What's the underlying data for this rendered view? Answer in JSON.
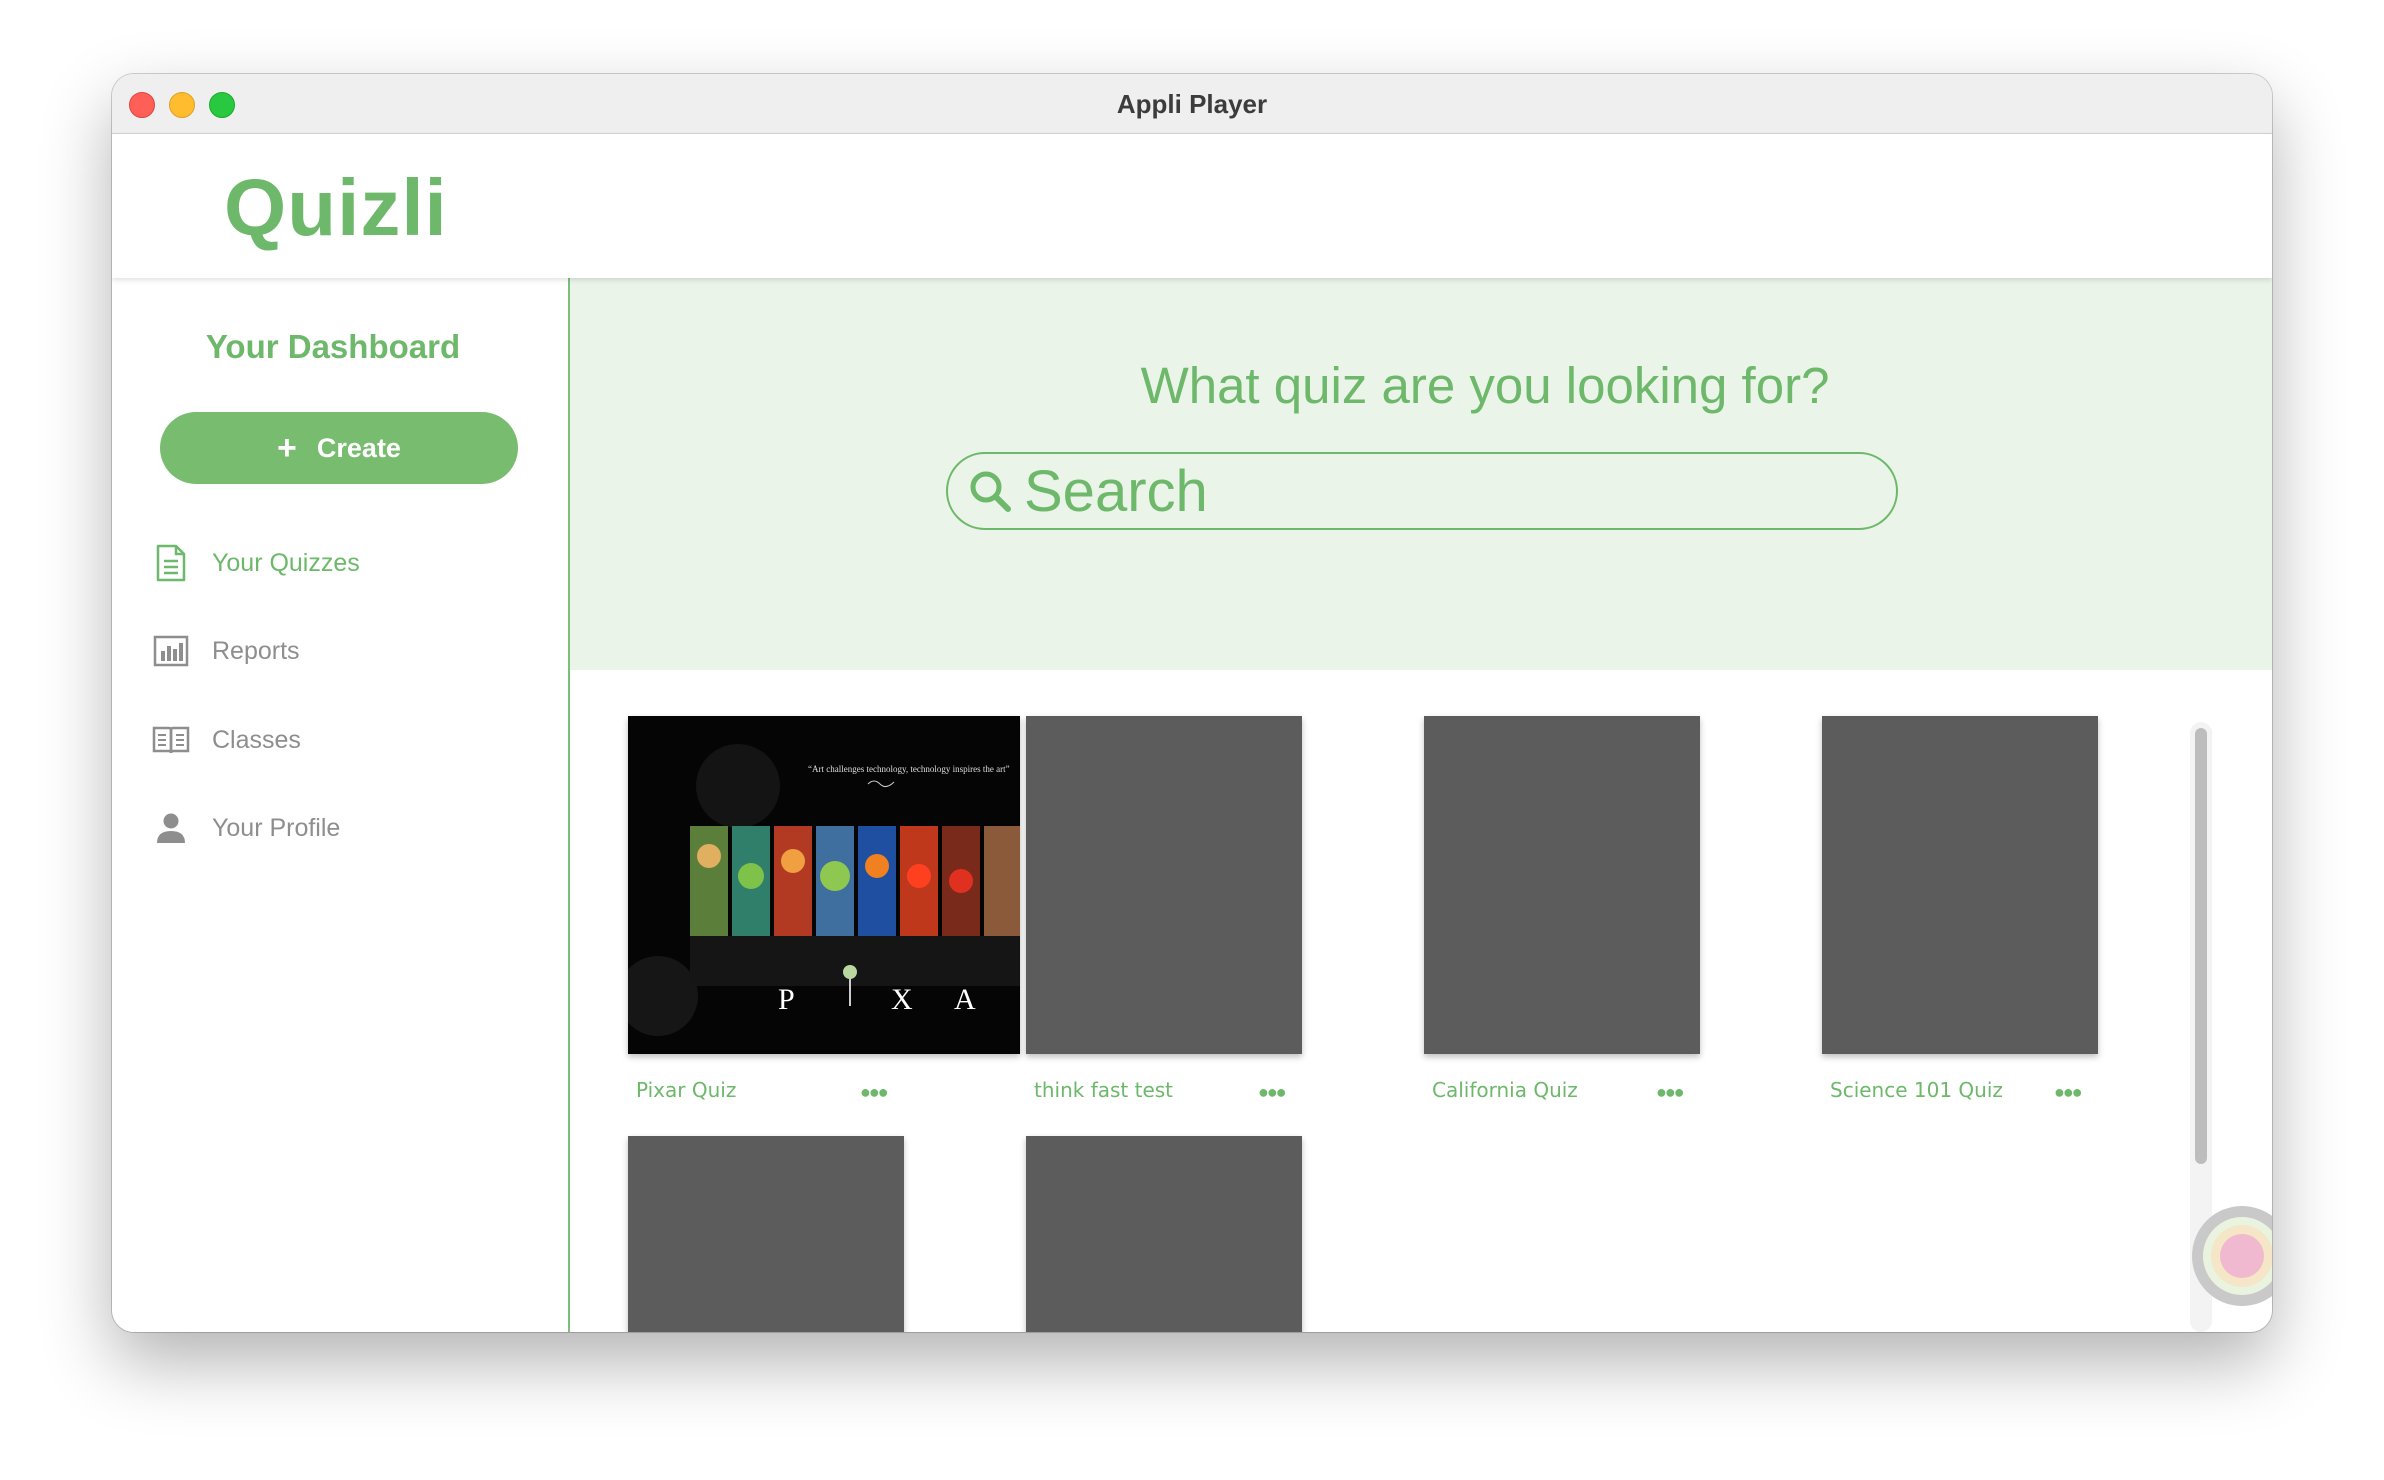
{
  "window": {
    "title": "Appli Player"
  },
  "app": {
    "logo": "Quizli"
  },
  "sidebar": {
    "title": "Your Dashboard",
    "create_label": "Create",
    "items": [
      {
        "label": "Your Quizzes",
        "icon": "document-icon",
        "active": true
      },
      {
        "label": "Reports",
        "icon": "bar-chart-icon",
        "active": false
      },
      {
        "label": "Classes",
        "icon": "book-icon",
        "active": false
      },
      {
        "label": "Your Profile",
        "icon": "person-icon",
        "active": false
      }
    ]
  },
  "hero": {
    "title": "What quiz are you looking for?",
    "search_placeholder": "Search"
  },
  "quizzes": [
    {
      "name": "Pixar Quiz",
      "thumbnail": "pixar-image"
    },
    {
      "name": "think fast test",
      "thumbnail": "placeholder"
    },
    {
      "name": "California Quiz",
      "thumbnail": "placeholder"
    },
    {
      "name": "Science 101 Quiz",
      "thumbnail": "placeholder"
    },
    {
      "name": "",
      "thumbnail": "placeholder"
    },
    {
      "name": "",
      "thumbnail": "placeholder"
    }
  ],
  "pixar_image": {
    "quote": "“Art challenges technology, technology inspires the art”",
    "letters": [
      "P",
      "X",
      "A"
    ]
  },
  "colors": {
    "brand_green": "#6db86a",
    "button_green": "#78bd6f",
    "hero_bg": "#eaf4e8",
    "placeholder_gray": "#5c5c5c"
  }
}
